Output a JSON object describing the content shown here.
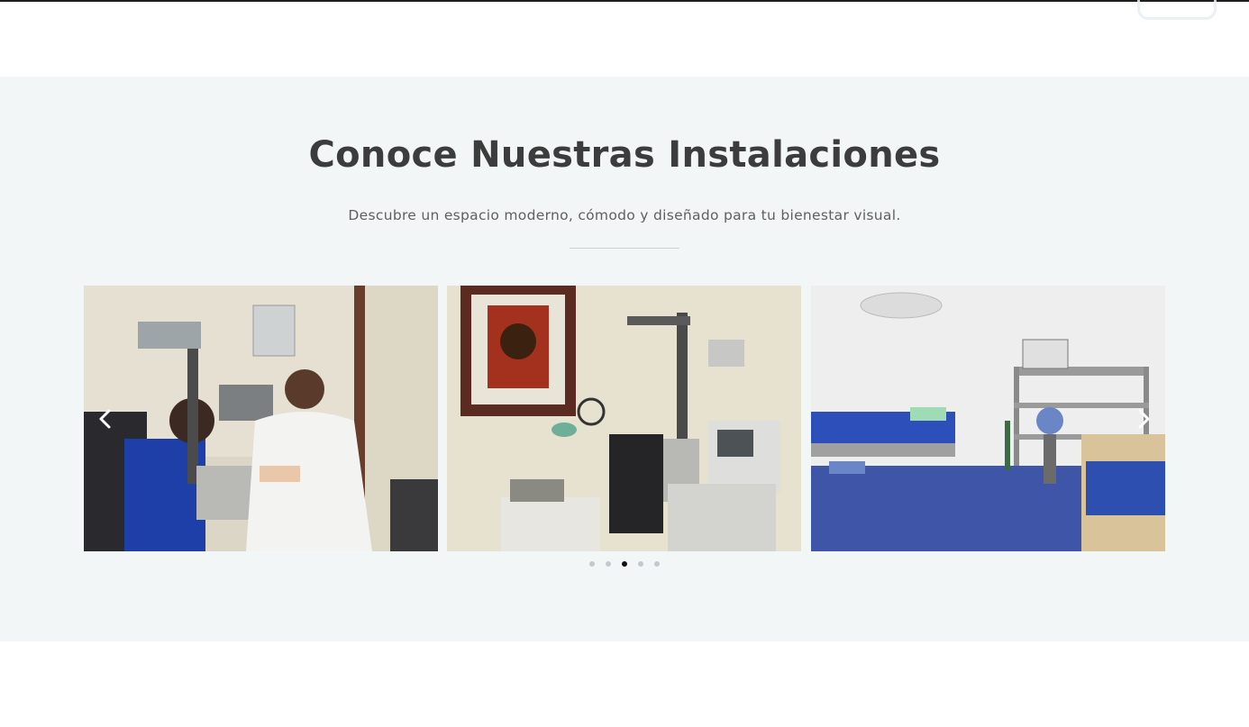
{
  "section": {
    "title": "Conoce Nuestras Instalaciones",
    "subtitle": "Descubre un espacio moderno, cómodo y diseñado para tu bienestar visual."
  },
  "carousel": {
    "slides": [
      {
        "image": "eye-exam-doctor-patient-photo"
      },
      {
        "image": "ophthalmology-equipment-room-photo"
      },
      {
        "image": "procedure-room-blue-floor-photo"
      }
    ],
    "prev_icon": "chevron-left-icon",
    "next_icon": "chevron-right-icon",
    "dot_count": 5,
    "active_dot": 3
  },
  "colors": {
    "section_bg": "#f3f6f7",
    "title": "#3c3c3c",
    "subtitle": "#5f5f5f",
    "dot_active": "#111111",
    "dot_inactive": "#c6c9cc"
  }
}
